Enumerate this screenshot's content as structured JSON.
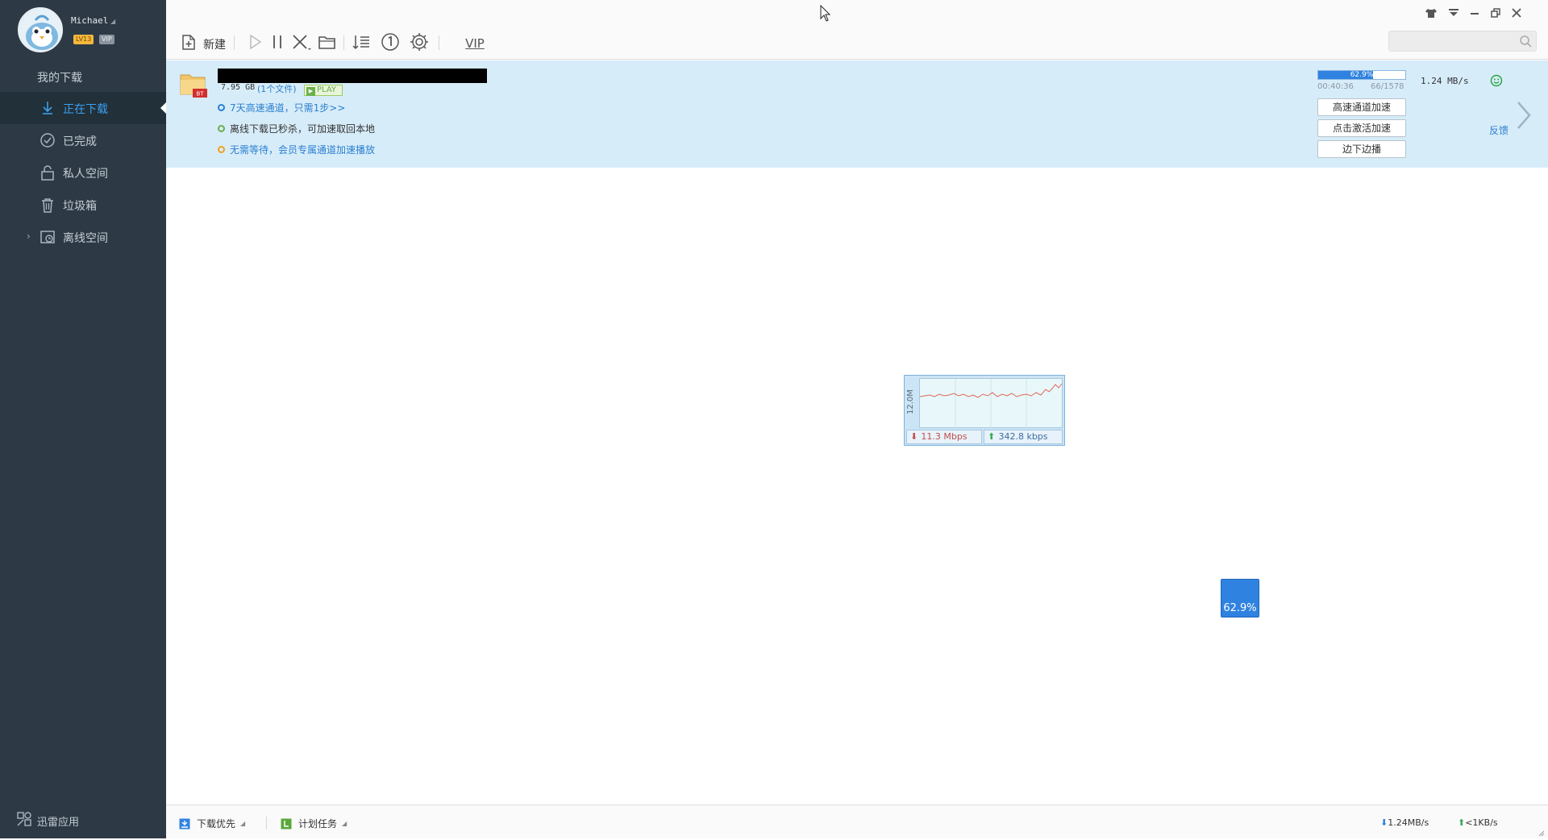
{
  "profile": {
    "username": "Michael",
    "level": "LV13",
    "vip": "VIP"
  },
  "nav": {
    "my_downloads": "我的下载",
    "downloading": "正在下载",
    "completed": "已完成",
    "private_space": "私人空间",
    "trash": "垃圾箱",
    "offline_space": "离线空间",
    "apps": "迅雷应用"
  },
  "toolbar": {
    "new_label": "新建",
    "vip_label": "VIP"
  },
  "search": {
    "placeholder": ""
  },
  "task": {
    "name": "",
    "size": "7.95 GB",
    "file_count": "(1个文件)",
    "play_label": "PLAY",
    "tips": [
      "7天高速通道，只需1步>>",
      "离线下载已秒杀，可加速取回本地",
      "无需等待，会员专属通道加速播放"
    ],
    "progress_percent": 62.9,
    "progress_label": "62.9%",
    "time_remaining": "00:40:36",
    "pieces": "66/1578",
    "speed": "1.24  MB/s",
    "buttons": {
      "highspeed": "高速通道加速",
      "activate": "点击激活加速",
      "streaming": "边下边播"
    },
    "feedback": "反馈"
  },
  "speed_monitor": {
    "scale": "12.0M",
    "download": "11.3 Mbps",
    "upload": "342.8 kbps"
  },
  "float_progress": {
    "label": "62.9%"
  },
  "statusbar": {
    "download_priority": "下载优先",
    "scheduled_tasks": "计划任务",
    "down_speed": "1.24MB/s",
    "up_speed": "<1KB/s"
  },
  "colors": {
    "sidebar": "#2d3a46",
    "accent": "#2f82e0",
    "task_row": "#d7ecf9"
  }
}
